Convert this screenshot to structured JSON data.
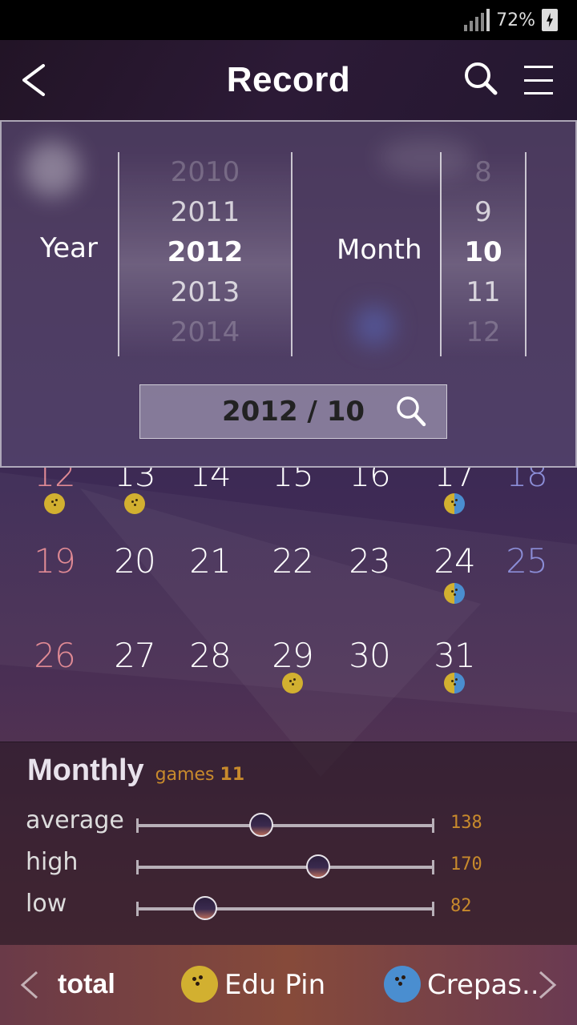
{
  "status_bar": {
    "battery_percent": "72%",
    "signal_icon": "signal-icon",
    "battery_icon": "battery-charging-icon"
  },
  "header": {
    "title": "Record",
    "back_icon": "chevron-left-icon",
    "search_icon": "search-icon",
    "menu_icon": "menu-icon"
  },
  "picker": {
    "year_label": "Year",
    "month_label": "Month",
    "years": [
      "2010",
      "2011",
      "2012",
      "2013",
      "2014"
    ],
    "selected_year": "2012",
    "months": [
      "8",
      "9",
      "10",
      "11",
      "12"
    ],
    "selected_month": "10",
    "date_display": "2012 / 10",
    "date_search_icon": "search-icon"
  },
  "calendar": {
    "weeks": [
      [
        "12",
        "13",
        "14",
        "15",
        "16",
        "17",
        "18"
      ],
      [
        "19",
        "20",
        "21",
        "22",
        "23",
        "24",
        "25"
      ],
      [
        "26",
        "27",
        "28",
        "29",
        "30",
        "31",
        ""
      ]
    ],
    "markers": {
      "12": "edu-pin",
      "13": "edu-pin",
      "17": "both",
      "24": "both",
      "29": "edu-pin",
      "31": "both"
    }
  },
  "monthly": {
    "title": "Monthly",
    "games_label": "games",
    "games_count": "11",
    "stats": [
      {
        "label": "average",
        "value": "138",
        "fraction": 0.42
      },
      {
        "label": "high",
        "value": "170",
        "fraction": 0.61
      },
      {
        "label": "low",
        "value": "82",
        "fraction": 0.23
      }
    ]
  },
  "bottom_nav": {
    "prev_icon": "chevron-left-icon",
    "next_icon": "chevron-right-icon",
    "tabs": [
      {
        "label": "total"
      },
      {
        "label": "Edu Pin",
        "color": "#d2b030",
        "icon": "bowling-ball-icon"
      },
      {
        "label": "Crepas..",
        "color": "#4a8ed0",
        "icon": "bowling-ball-icon"
      }
    ]
  },
  "colors": {
    "accent": "#c88a2c",
    "edu_pin": "#d2b030",
    "crepas": "#4a8ed0",
    "sunday": "#e08a94",
    "saturday": "#8c8ed8"
  }
}
